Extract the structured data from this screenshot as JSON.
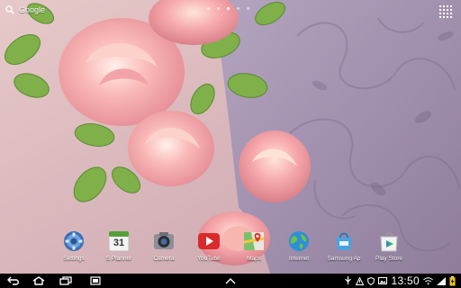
{
  "search": {
    "label": "Google"
  },
  "pages": {
    "count": 5,
    "active": 3
  },
  "dock": [
    {
      "label": "Settings",
      "icon": "settings-icon"
    },
    {
      "label": "S Planner",
      "icon": "calendar-icon",
      "badge": "31"
    },
    {
      "label": "Camera",
      "icon": "camera-icon"
    },
    {
      "label": "YouTube",
      "icon": "youtube-icon"
    },
    {
      "label": "Maps",
      "icon": "maps-icon"
    },
    {
      "label": "Internet",
      "icon": "globe-icon"
    },
    {
      "label": "Samsung Ap",
      "icon": "samsung-apps-icon"
    },
    {
      "label": "Play Store",
      "icon": "play-store-icon"
    }
  ],
  "status": {
    "time": "13:50"
  },
  "colors": {
    "wallpaper_left": "#d9b3b8",
    "wallpaper_right": "#9d8aa8",
    "navbar": "#000000"
  }
}
